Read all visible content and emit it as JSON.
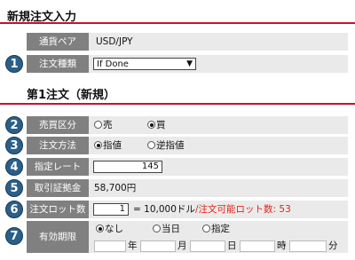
{
  "sections": {
    "new_order": "新規注文入力",
    "first_order": "第1注文（新規）"
  },
  "badges": [
    "1",
    "2",
    "3",
    "4",
    "5",
    "6",
    "7"
  ],
  "rows": {
    "currency_pair": {
      "label": "通貨ペア",
      "value": "USD/JPY"
    },
    "order_type": {
      "label": "注文種類",
      "selected": "If Done"
    },
    "side": {
      "label": "売買区分",
      "options": [
        "売",
        "買"
      ],
      "selected": "買"
    },
    "method": {
      "label": "注文方法",
      "options": [
        "指値",
        "逆指値"
      ],
      "selected": "指値"
    },
    "rate": {
      "label": "指定レート",
      "value": "145"
    },
    "margin": {
      "label": "取引証拠金",
      "value": "58,700円"
    },
    "lots": {
      "label": "注文ロット数",
      "value": "1",
      "unit_text": "= 10,000ドル",
      "note": "/注文可能ロット数: 53"
    },
    "expiry": {
      "label": "有効期限",
      "options": [
        "なし",
        "当日",
        "指定"
      ],
      "selected": "なし",
      "date_units": [
        "年",
        "月",
        "日",
        "時",
        "分"
      ]
    }
  },
  "colors": {
    "accent": "#c8102e",
    "label_bg": "#808080",
    "badge": "#2b5f8a",
    "note": "#e0231b"
  }
}
